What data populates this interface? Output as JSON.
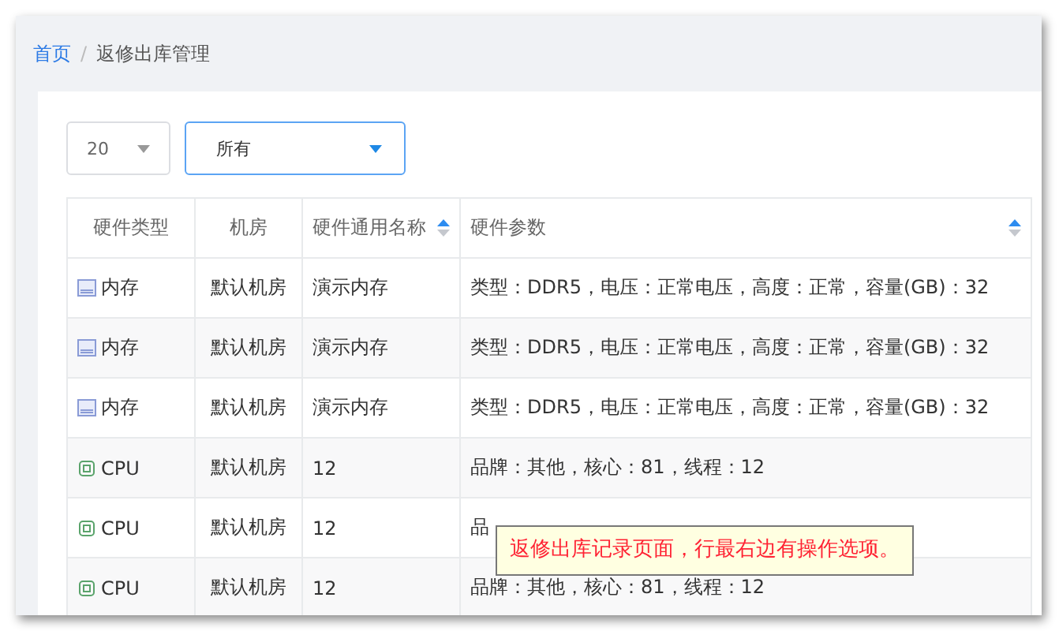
{
  "breadcrumb": [
    {
      "label": "首页",
      "link": true
    },
    {
      "label": "返修出库管理",
      "link": false
    }
  ],
  "breadcrumb_separator": "/",
  "filters": {
    "page_size": "20",
    "status": "所有"
  },
  "table": {
    "columns": [
      {
        "label": "硬件类型"
      },
      {
        "label": "机房"
      },
      {
        "label": "硬件通用名称",
        "sortable": true,
        "sorted_ascending": true
      },
      {
        "label": "硬件参数",
        "sortable": true,
        "sorted_ascending": true
      }
    ],
    "rows": [
      {
        "kind": "memory",
        "type": "内存",
        "room": "默认机房",
        "name": "演示内存",
        "params": "类型：DDR5，电压：正常电压，高度：正常，容量(GB)：32"
      },
      {
        "kind": "memory",
        "type": "内存",
        "room": "默认机房",
        "name": "演示内存",
        "params": "类型：DDR5，电压：正常电压，高度：正常，容量(GB)：32"
      },
      {
        "kind": "memory",
        "type": "内存",
        "room": "默认机房",
        "name": "演示内存",
        "params": "类型：DDR5，电压：正常电压，高度：正常，容量(GB)：32"
      },
      {
        "kind": "cpu",
        "type": "CPU",
        "room": "默认机房",
        "name": "12",
        "params": "品牌：其他，核心：81，线程：12"
      },
      {
        "kind": "cpu",
        "type": "CPU",
        "room": "默认机房",
        "name": "12",
        "params": "品"
      },
      {
        "kind": "cpu",
        "type": "CPU",
        "room": "默认机房",
        "name": "12",
        "params": "品牌：其他，核心：81，线程：12"
      }
    ]
  },
  "tooltip": "返修出库记录页面，行最右边有操作选项。"
}
